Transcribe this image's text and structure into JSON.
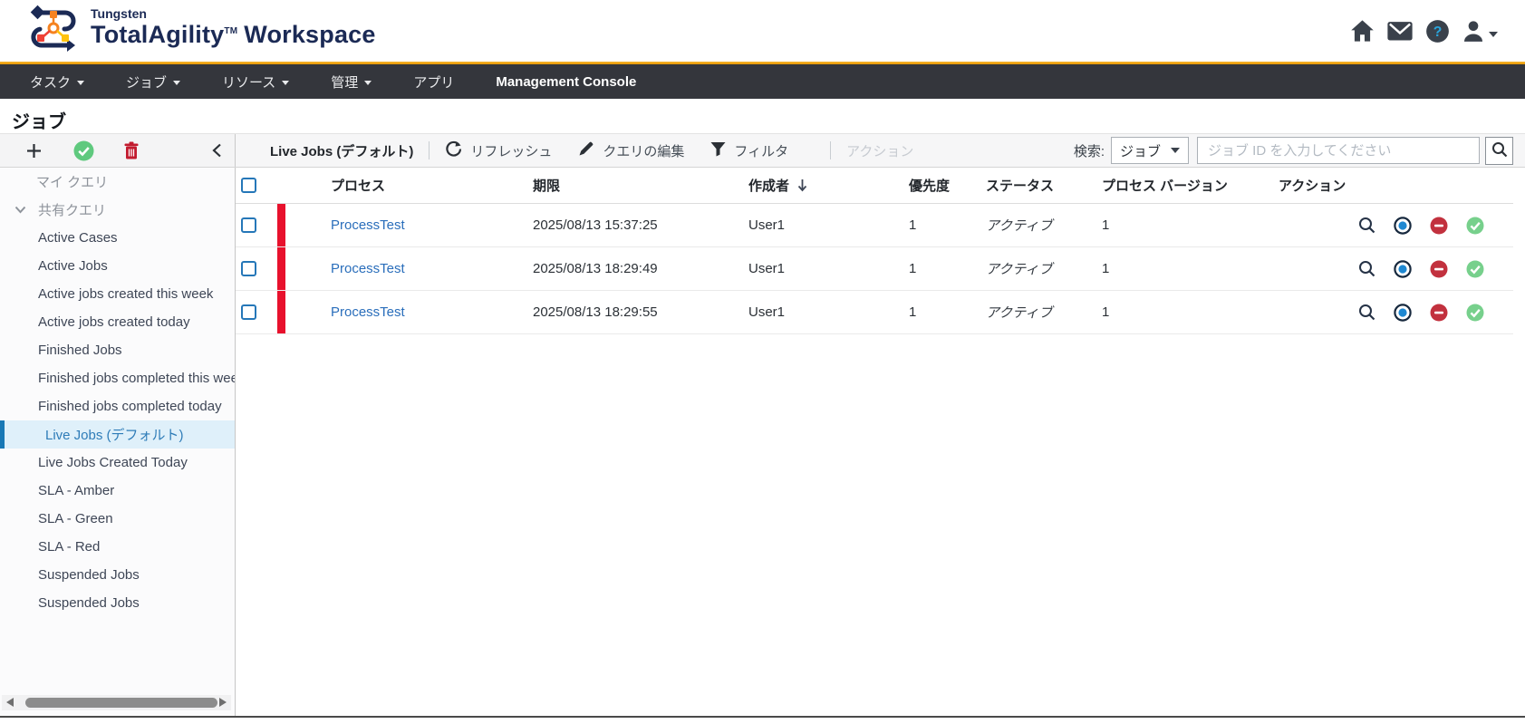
{
  "brand": {
    "company": "Tungsten",
    "product": "TotalAgility",
    "tm": "TM",
    "suffix": "Workspace"
  },
  "header": {
    "help_glyph": "?"
  },
  "nav": {
    "items": [
      {
        "label": "タスク"
      },
      {
        "label": "ジョブ"
      },
      {
        "label": "リソース"
      },
      {
        "label": "管理"
      },
      {
        "label": "アプリ"
      },
      {
        "label": "Management Console"
      }
    ]
  },
  "page_title": "ジョブ",
  "toolbar": {
    "query_title": "Live Jobs (デフォルト)",
    "refresh_label": "リフレッシュ",
    "edit_query_label": "クエリの編集",
    "filter_label": "フィルタ",
    "actions_label": "アクション",
    "search_label": "検索:",
    "search_scope": "ジョブ",
    "search_placeholder": "ジョブ ID を入力してください"
  },
  "sidebar": {
    "my_queries_label": "マイ クエリ",
    "shared_queries_label": "共有クエリ",
    "items": [
      {
        "label": "Active Cases"
      },
      {
        "label": "Active Jobs"
      },
      {
        "label": "Active jobs created this week"
      },
      {
        "label": "Active jobs created today"
      },
      {
        "label": "Finished Jobs"
      },
      {
        "label": "Finished jobs completed this week"
      },
      {
        "label": "Finished jobs completed today"
      },
      {
        "label": "Live Jobs (デフォルト)",
        "selected": true
      },
      {
        "label": "Live Jobs Created Today"
      },
      {
        "label": "SLA - Amber"
      },
      {
        "label": "SLA - Green"
      },
      {
        "label": "SLA - Red"
      },
      {
        "label": "Suspended Jobs"
      },
      {
        "label": "Suspended Jobs"
      }
    ]
  },
  "table": {
    "columns": {
      "process": "プロセス",
      "due": "期限",
      "creator": "作成者",
      "priority": "優先度",
      "status": "ステータス",
      "version": "プロセス バージョン",
      "actions": "アクション"
    },
    "sort": {
      "column": "作成者",
      "direction": "desc"
    },
    "rows": [
      {
        "process": "ProcessTest",
        "due": "2025/08/13 15:37:25",
        "creator": "User1",
        "priority": "1",
        "status": "アクティブ",
        "version": "1"
      },
      {
        "process": "ProcessTest",
        "due": "2025/08/13 18:29:49",
        "creator": "User1",
        "priority": "1",
        "status": "アクティブ",
        "version": "1"
      },
      {
        "process": "ProcessTest",
        "due": "2025/08/13 18:29:55",
        "creator": "User1",
        "priority": "1",
        "status": "アクティブ",
        "version": "1"
      }
    ]
  },
  "colors": {
    "accent_gold": "#F0A30A",
    "nav_bg": "#34363C",
    "brand_navy": "#1B2A55",
    "link_blue": "#2A6EBB",
    "selected_bg": "#DFF0FA",
    "selected_text": "#2E7CB8",
    "selected_bar": "#1878B5",
    "row_flag_red": "#E8112D",
    "success_green": "#70CE8C",
    "danger_red": "#C2313E",
    "radio_blue": "#1E88D2"
  }
}
